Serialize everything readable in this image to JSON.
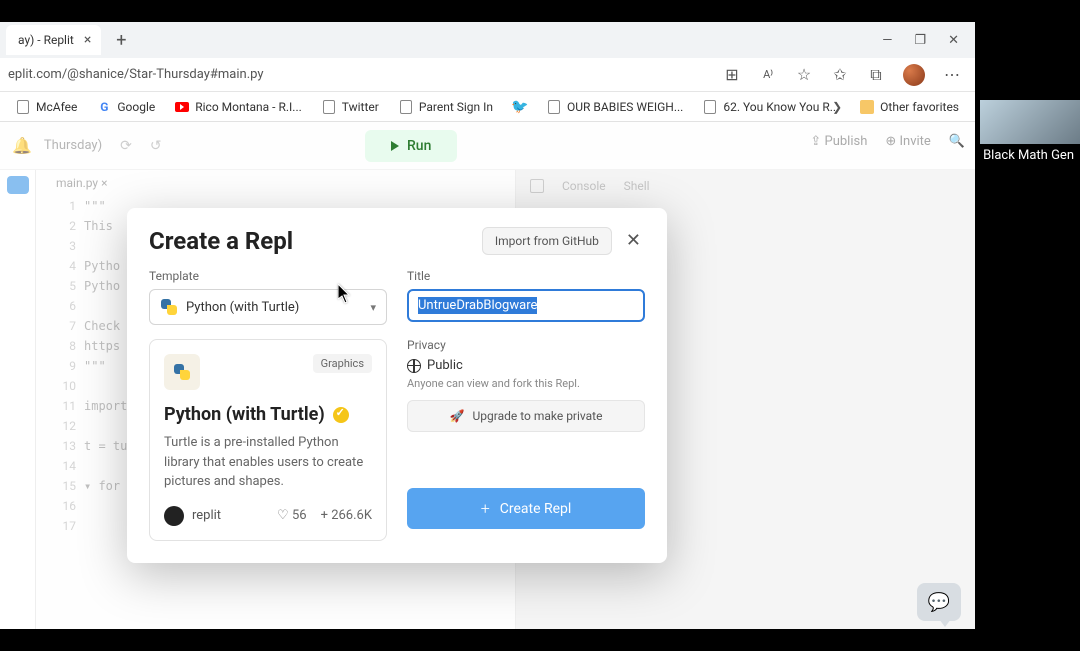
{
  "browser": {
    "tab_title": "ay) - Replit",
    "url": "eplit.com/@shanice/Star-Thursday#main.py",
    "bookmarks": [
      {
        "label": "McAfee",
        "kind": "doc"
      },
      {
        "label": "Google",
        "kind": "google"
      },
      {
        "label": "Rico Montana - R.I...",
        "kind": "youtube"
      },
      {
        "label": "Twitter",
        "kind": "doc"
      },
      {
        "label": "Parent Sign In",
        "kind": "doc"
      },
      {
        "label": "",
        "kind": "twitter"
      },
      {
        "label": "OUR BABIES WEIGH...",
        "kind": "doc"
      },
      {
        "label": "62. You Know You R...",
        "kind": "doc"
      }
    ],
    "other_favorites": "Other favorites"
  },
  "header": {
    "project": "Thursday)",
    "run": "Run",
    "publish": "Publish",
    "invite": "Invite"
  },
  "editor": {
    "tab": "main.py",
    "lines": [
      "1",
      "2",
      "3",
      "4",
      "5",
      "6",
      "7",
      "8",
      "9",
      "10",
      "11",
      "12",
      "13",
      "14",
      "15",
      "16",
      "17"
    ],
    "code_preview": "\"\"\"\nThis\n\nPytho\nPytho\n\nCheck\nhttps\n\"\"\"\n\nimport\n\nt = tu\n\n▾ for\n\n"
  },
  "console": {
    "tab1": "Console",
    "tab2": "Shell"
  },
  "modal": {
    "title": "Create a Repl",
    "import": "Import from GitHub",
    "template_label": "Template",
    "template_value": "Python (with Turtle)",
    "card": {
      "category": "Graphics",
      "name": "Python (with Turtle)",
      "desc": "Turtle is a pre-installed Python library that enables users to create pictures and shapes.",
      "author": "replit",
      "likes": "56",
      "forks": "266.6K"
    },
    "title_label": "Title",
    "title_value": "UntrueDrabBlogware",
    "privacy_label": "Privacy",
    "privacy_value": "Public",
    "privacy_sub": "Anyone can view and fork this Repl.",
    "upgrade": "Upgrade to make private",
    "create": "Create Repl"
  },
  "overlay": {
    "label": "Black Math Gen"
  }
}
